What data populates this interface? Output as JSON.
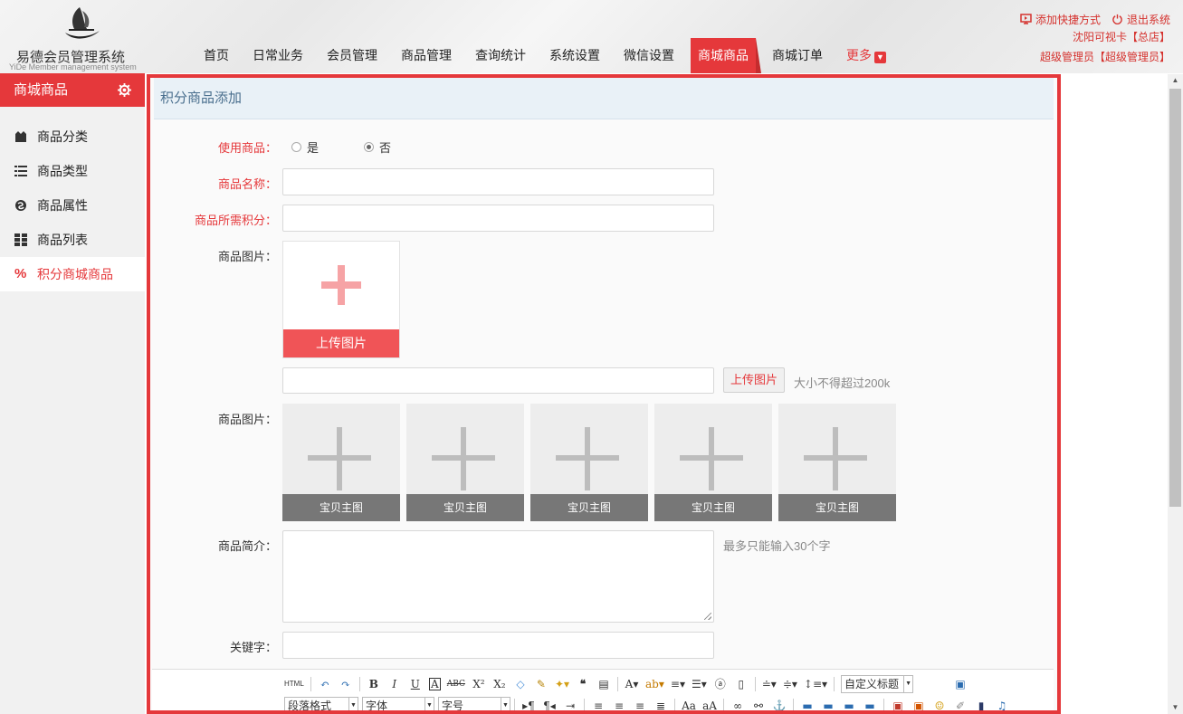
{
  "logo": {
    "cn": "易德会员管理系统",
    "en": "YiDe Member management system"
  },
  "nav": [
    {
      "label": "首页",
      "active": false
    },
    {
      "label": "日常业务",
      "active": false
    },
    {
      "label": "会员管理",
      "active": false
    },
    {
      "label": "商品管理",
      "active": false
    },
    {
      "label": "查询统计",
      "active": false
    },
    {
      "label": "系统设置",
      "active": false
    },
    {
      "label": "微信设置",
      "active": false
    },
    {
      "label": "商城商品",
      "active": true
    },
    {
      "label": "商城订单",
      "active": false
    },
    {
      "label": "更多",
      "active": false
    }
  ],
  "top_right": {
    "add_shortcut": "添加快捷方式",
    "logout": "退出系统",
    "store": "沈阳可视卡【总店】",
    "user": "超级管理员【超级管理员】"
  },
  "sidebar": {
    "title": "商城商品",
    "items": [
      {
        "label": "商品分类",
        "icon": "category-icon"
      },
      {
        "label": "商品类型",
        "icon": "list-icon"
      },
      {
        "label": "商品属性",
        "icon": "attribute-icon"
      },
      {
        "label": "商品列表",
        "icon": "grid-icon"
      },
      {
        "label": "积分商城商品",
        "icon": "percent-icon",
        "active": true
      }
    ],
    "active_mark": "%"
  },
  "panel": {
    "title": "积分商品添加"
  },
  "form": {
    "use_label": "使用商品：",
    "use_yes": "是",
    "use_no": "否",
    "use_selected": "否",
    "name_label": "商品名称：",
    "points_label": "商品所需积分：",
    "image_label": "商品图片：",
    "upload_label": "上传图片",
    "upload_btn": "上传图片",
    "size_hint": "大小不得超过200k",
    "images_label": "商品图片：",
    "thumb_caption": "宝贝主图",
    "intro_label": "商品简介：",
    "intro_hint": "最多只能输入30个字",
    "keyword_label": "关键字："
  },
  "editor": {
    "custom_title": "自定义标题",
    "paragraph": "段落格式",
    "font": "字体",
    "size": "字号"
  },
  "colors": {
    "accent": "#e5383b",
    "panel_head": "#e9f1f7"
  }
}
